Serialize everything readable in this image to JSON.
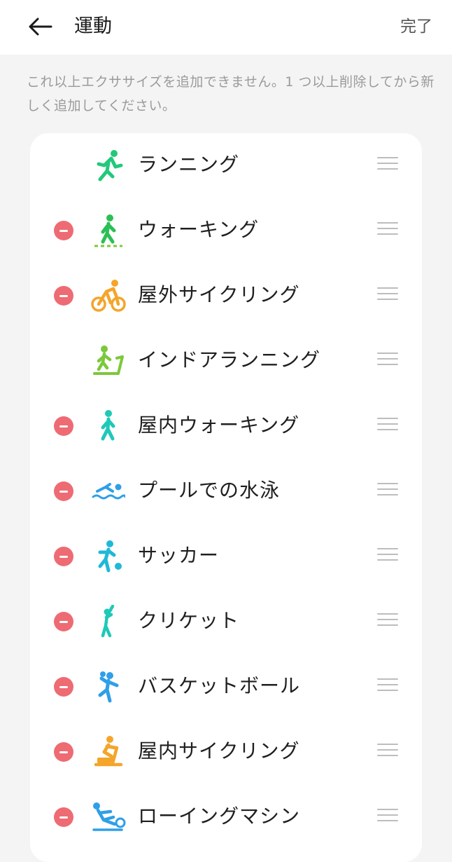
{
  "header": {
    "title": "運動",
    "done_label": "完了"
  },
  "hint": "これ以上エクササイズを追加できません。1 つ以上削除してから新しく追加してください。",
  "colors": {
    "remove": "#ee6b73",
    "green": "#22c97a",
    "lime": "#7cc83a",
    "orange": "#f4a52a",
    "blue": "#2f9fe8",
    "teal": "#1ec9b7"
  },
  "exercises": [
    {
      "label": "ランニング",
      "removable": false,
      "icon": "running-icon"
    },
    {
      "label": "ウォーキング",
      "removable": true,
      "icon": "walking-icon"
    },
    {
      "label": "屋外サイクリング",
      "removable": true,
      "icon": "outdoor-cycling-icon"
    },
    {
      "label": "インドアランニング",
      "removable": false,
      "icon": "treadmill-icon"
    },
    {
      "label": "屋内ウォーキング",
      "removable": true,
      "icon": "indoor-walking-icon"
    },
    {
      "label": "プールでの水泳",
      "removable": true,
      "icon": "swimming-icon"
    },
    {
      "label": "サッカー",
      "removable": true,
      "icon": "soccer-icon"
    },
    {
      "label": "クリケット",
      "removable": true,
      "icon": "cricket-icon"
    },
    {
      "label": "バスケットボール",
      "removable": true,
      "icon": "basketball-icon"
    },
    {
      "label": "屋内サイクリング",
      "removable": true,
      "icon": "indoor-cycling-icon"
    },
    {
      "label": "ローイングマシン",
      "removable": true,
      "icon": "rowing-machine-icon"
    }
  ]
}
